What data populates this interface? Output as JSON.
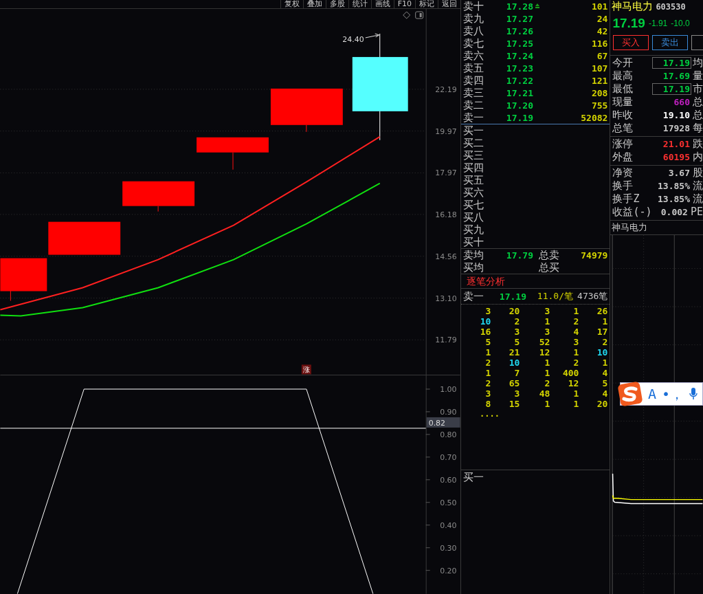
{
  "toolbar": [
    {
      "label": "复权"
    },
    {
      "label": "叠加"
    },
    {
      "label": "多股"
    },
    {
      "label": "统计"
    },
    {
      "label": "画线"
    },
    {
      "label": "F10"
    },
    {
      "label": "标记"
    },
    {
      "label": "返回"
    }
  ],
  "main_chart": {
    "high_label": "24.40",
    "price_ticks": [
      "22.19",
      "19.97",
      "17.97",
      "16.18",
      "14.56",
      "13.10",
      "11.79"
    ],
    "marker": "涨"
  },
  "indicator_chart": {
    "ticks": [
      "1.00",
      "0.90",
      "0.80",
      "0.70",
      "0.60",
      "0.50",
      "0.40",
      "0.30",
      "0.20"
    ],
    "cursor_value": "0.82"
  },
  "asks": [
    {
      "label": "卖十",
      "price": "17.28",
      "volume": "101",
      "flag": true
    },
    {
      "label": "卖九",
      "price": "17.27",
      "volume": "24",
      "flag": false
    },
    {
      "label": "卖八",
      "price": "17.26",
      "volume": "42",
      "flag": false
    },
    {
      "label": "卖七",
      "price": "17.25",
      "volume": "116",
      "flag": false
    },
    {
      "label": "卖六",
      "price": "17.24",
      "volume": "67",
      "flag": false
    },
    {
      "label": "卖五",
      "price": "17.23",
      "volume": "107",
      "flag": false
    },
    {
      "label": "卖四",
      "price": "17.22",
      "volume": "121",
      "flag": false
    },
    {
      "label": "卖三",
      "price": "17.21",
      "volume": "208",
      "flag": false
    },
    {
      "label": "卖二",
      "price": "17.20",
      "volume": "755",
      "flag": false
    },
    {
      "label": "卖一",
      "price": "17.19",
      "volume": "52082",
      "flag": false
    }
  ],
  "bids": [
    {
      "label": "买一"
    },
    {
      "label": "买二"
    },
    {
      "label": "买三"
    },
    {
      "label": "买四"
    },
    {
      "label": "买五"
    },
    {
      "label": "买六"
    },
    {
      "label": "买七"
    },
    {
      "label": "买八"
    },
    {
      "label": "买九"
    },
    {
      "label": "买十"
    }
  ],
  "summary": [
    {
      "label": "卖均",
      "price": "17.79",
      "total_label": "总卖",
      "total": "74979"
    },
    {
      "label": "买均",
      "total_label": "总买"
    }
  ],
  "tick_analysis": {
    "title": "逐笔分析",
    "header": {
      "label": "卖一",
      "price": "17.19",
      "average": "11.0/笔",
      "count": "4736笔"
    },
    "rows": [
      [
        {
          "text": "3",
          "color": "#d4d400"
        },
        {
          "text": "20",
          "color": "#d4d400"
        },
        {
          "text": "3",
          "color": "#d4d400"
        },
        {
          "text": "1",
          "color": "#d4d400"
        },
        {
          "text": "26",
          "color": "#d4d400"
        }
      ],
      [
        {
          "text": "10",
          "color": "#20d8f0"
        },
        {
          "text": "2",
          "color": "#d4d400"
        },
        {
          "text": "1",
          "color": "#d4d400"
        },
        {
          "text": "2",
          "color": "#d4d400"
        },
        {
          "text": "1",
          "color": "#d4d400"
        }
      ],
      [
        {
          "text": "16",
          "color": "#d4d400"
        },
        {
          "text": "3",
          "color": "#d4d400"
        },
        {
          "text": "3",
          "color": "#d4d400"
        },
        {
          "text": "4",
          "color": "#d4d400"
        },
        {
          "text": "17",
          "color": "#d4d400"
        }
      ],
      [
        {
          "text": "5",
          "color": "#d4d400"
        },
        {
          "text": "5",
          "color": "#d4d400"
        },
        {
          "text": "52",
          "color": "#d4d400"
        },
        {
          "text": "3",
          "color": "#d4d400"
        },
        {
          "text": "2",
          "color": "#d4d400"
        }
      ],
      [
        {
          "text": "1",
          "color": "#d4d400"
        },
        {
          "text": "21",
          "color": "#d4d400"
        },
        {
          "text": "12",
          "color": "#d4d400"
        },
        {
          "text": "1",
          "color": "#d4d400"
        },
        {
          "text": "10",
          "color": "#20d8f0"
        }
      ],
      [
        {
          "text": "2",
          "color": "#d4d400"
        },
        {
          "text": "10",
          "color": "#20d8f0"
        },
        {
          "text": "1",
          "color": "#d4d400"
        },
        {
          "text": "2",
          "color": "#d4d400"
        },
        {
          "text": "1",
          "color": "#d4d400"
        }
      ],
      [
        {
          "text": "1",
          "color": "#d4d400"
        },
        {
          "text": "7",
          "color": "#d4d400"
        },
        {
          "text": "1",
          "color": "#d4d400"
        },
        {
          "text": "400",
          "color": "#d4d400"
        },
        {
          "text": "4",
          "color": "#d4d400"
        }
      ],
      [
        {
          "text": "2",
          "color": "#d4d400"
        },
        {
          "text": "65",
          "color": "#d4d400"
        },
        {
          "text": "2",
          "color": "#d4d400"
        },
        {
          "text": "12",
          "color": "#d4d400"
        },
        {
          "text": "5",
          "color": "#d4d400"
        }
      ],
      [
        {
          "text": "3",
          "color": "#d4d400"
        },
        {
          "text": "3",
          "color": "#d4d400"
        },
        {
          "text": "48",
          "color": "#d4d400"
        },
        {
          "text": "1",
          "color": "#d4d400"
        },
        {
          "text": "4",
          "color": "#d4d400"
        }
      ],
      [
        {
          "text": "8",
          "color": "#d4d400"
        },
        {
          "text": "15",
          "color": "#d4d400"
        },
        {
          "text": "1",
          "color": "#d4d400"
        },
        {
          "text": "1",
          "color": "#d4d400"
        },
        {
          "text": "20",
          "color": "#d4d400"
        }
      ]
    ],
    "more": "...."
  },
  "lower_label": "买一",
  "quote": {
    "name": "神马电力",
    "code": "603530",
    "price": "17.19",
    "change": "-1.91",
    "percent": "-10.0"
  },
  "trade_buttons": [
    {
      "label": "买入",
      "kind": "buy"
    },
    {
      "label": "卖出",
      "kind": "sell"
    },
    {
      "kind": "cut"
    }
  ],
  "info_groups": [
    [
      {
        "label": "今开",
        "value": "17.19",
        "color": "#00d040",
        "boxed": true,
        "side": "均"
      },
      {
        "label": "最高",
        "value": "17.69",
        "color": "#00d040",
        "boxed": false,
        "side": "量"
      },
      {
        "label": "最低",
        "value": "17.19",
        "color": "#00d040",
        "boxed": true,
        "side": "市"
      },
      {
        "label": "现量",
        "value": "660",
        "color": "#c020c0",
        "boxed": false,
        "side": "总"
      },
      {
        "label": "昨收",
        "value": "19.10",
        "color": "#ffffff",
        "boxed": false,
        "side": "总"
      },
      {
        "label": "总笔",
        "value": "17928",
        "color": "#c8c8c8",
        "boxed": false,
        "side": "每"
      }
    ],
    [
      {
        "label": "涨停",
        "value": "21.01",
        "color": "#ff3030",
        "boxed": false,
        "side": "跌"
      },
      {
        "label": "外盘",
        "value": "60195",
        "color": "#ff3030",
        "boxed": false,
        "side": "内"
      }
    ],
    [
      {
        "label": "净资",
        "value": "3.67",
        "color": "#c8c8c8",
        "boxed": false,
        "side": "股"
      },
      {
        "label": "换手",
        "value": "13.85%",
        "color": "#c8c8c8",
        "boxed": false,
        "side": "流"
      },
      {
        "label": "换手Z",
        "value": "13.85%",
        "color": "#c8c8c8",
        "boxed": false,
        "side": "流"
      },
      {
        "label": "收益(-)",
        "value": "0.002",
        "color": "#c8c8c8",
        "boxed": false,
        "side": "PE"
      }
    ]
  ],
  "mini_chart_title": "神马电力",
  "ime_toolbar": {
    "items": [
      "A",
      "•，"
    ]
  }
}
